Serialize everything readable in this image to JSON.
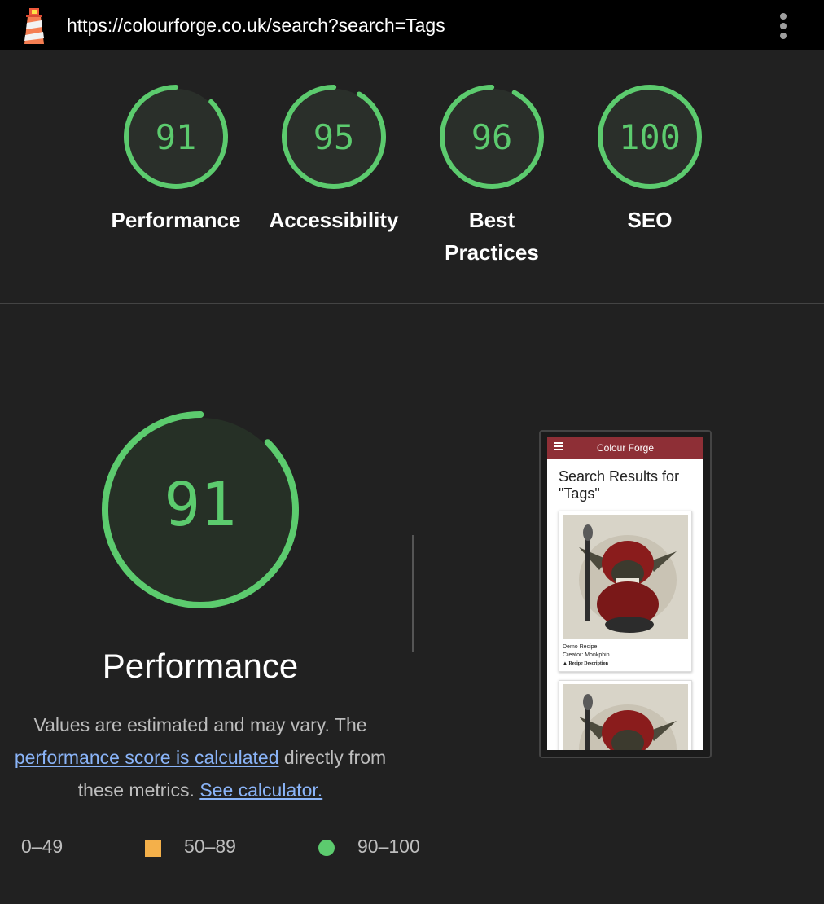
{
  "browser": {
    "url": "https://colourforge.co.uk/search?search=Tags"
  },
  "summary": {
    "gauges": [
      {
        "score": "91",
        "label": "Performance",
        "value": 91
      },
      {
        "score": "95",
        "label": "Accessibility",
        "value": 95
      },
      {
        "score": "96",
        "label": "Best Practices",
        "value": 96
      },
      {
        "score": "100",
        "label": "SEO",
        "value": 100
      }
    ]
  },
  "detail": {
    "score": "91",
    "value": 91,
    "title": "Performance",
    "desc_line1": "Values are estimated and may vary. The",
    "link1": "performance score is calculated",
    "desc_mid": " directly from",
    "desc_line3": "these metrics. ",
    "link2": "See calculator."
  },
  "legend": {
    "fail": "0–49",
    "average": "50–89",
    "pass": "90–100"
  },
  "screenshot": {
    "app_title": "Colour Forge",
    "heading": "Search Results for \"Tags\"",
    "card": {
      "line1": "Demo Recipe",
      "line2": "Creator: Monkphin",
      "line3": "▲ Recipe Description"
    }
  },
  "colors": {
    "pass": "#5ccb6e",
    "average": "#f4b04a",
    "fail": "#e5534b",
    "brand_bar": "#8e2f36"
  }
}
